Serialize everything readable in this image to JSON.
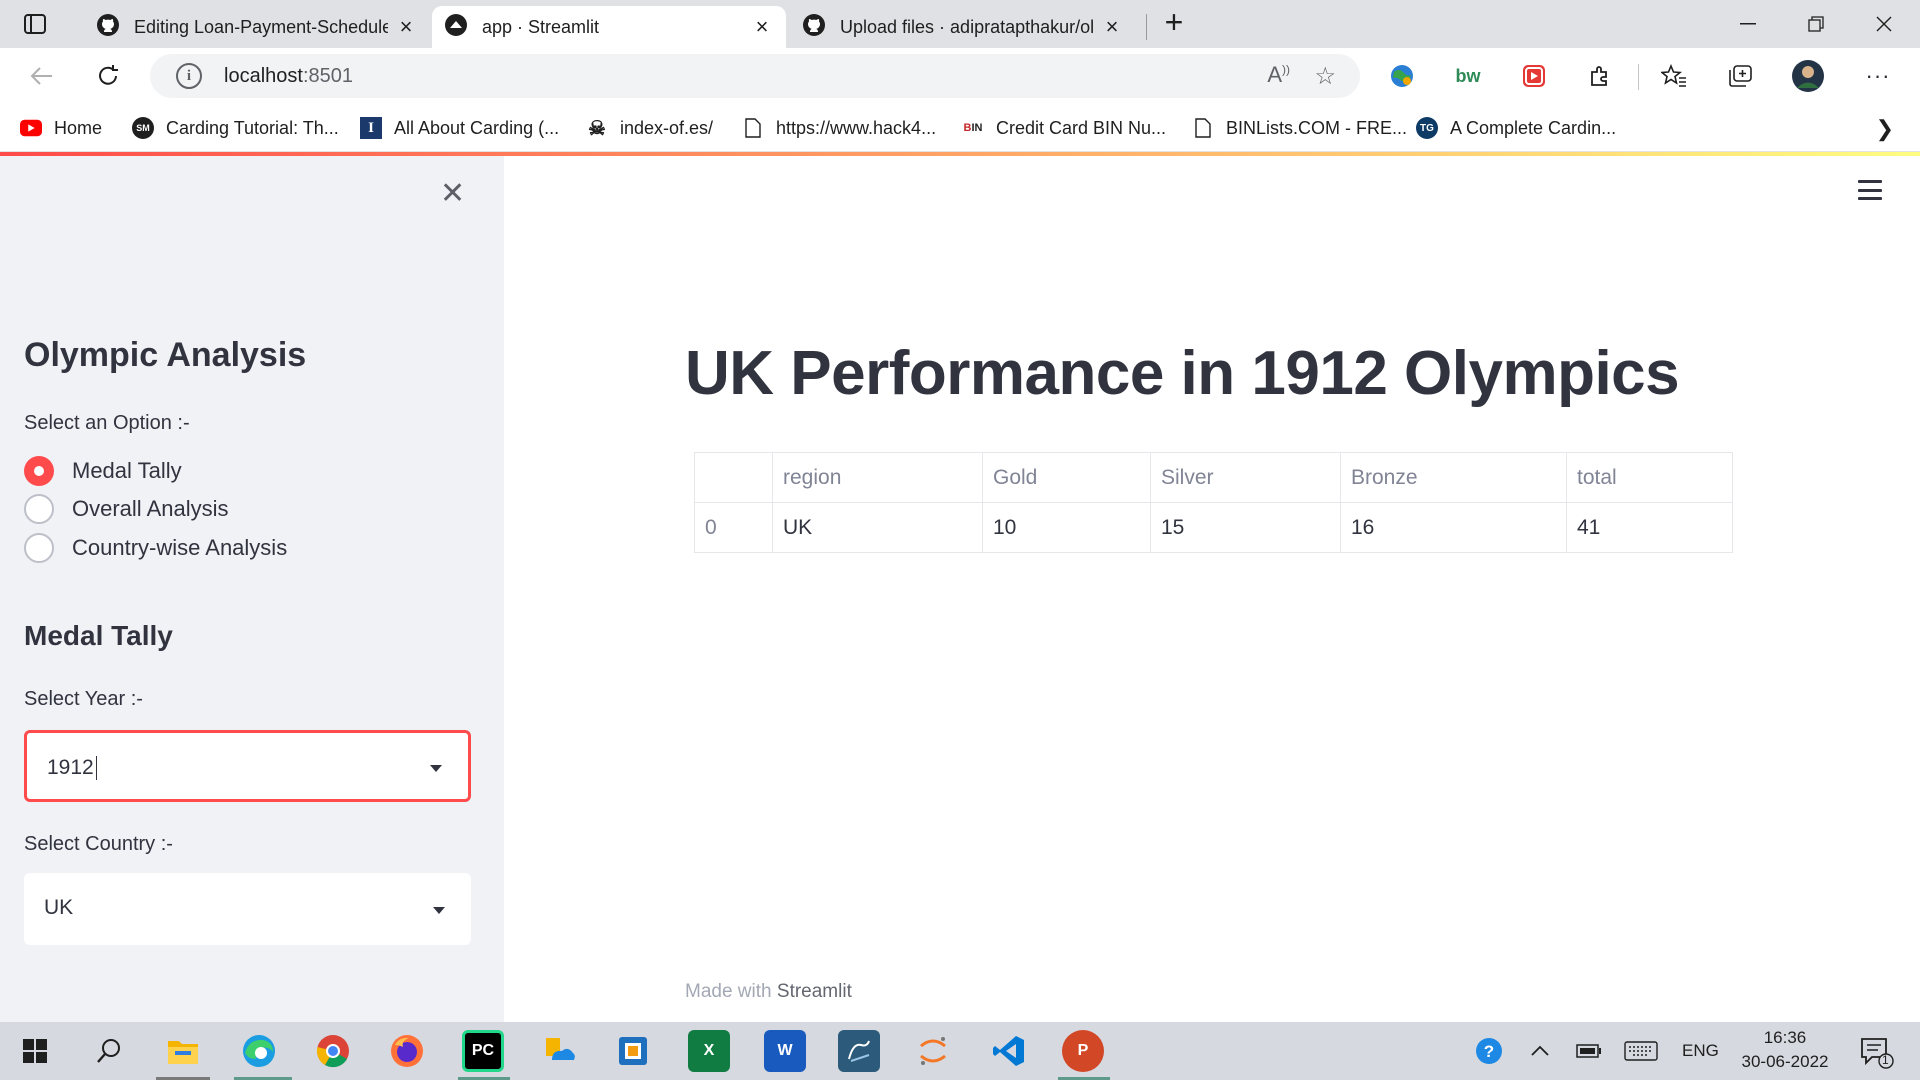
{
  "browser": {
    "tabs": [
      {
        "title": "Editing Loan-Payment-Scheduler",
        "icon": "github-icon",
        "active": false
      },
      {
        "title": "app · Streamlit",
        "icon": "streamlit-icon",
        "active": true
      },
      {
        "title": "Upload files · adipratapthakur/ol",
        "icon": "github-icon",
        "active": false
      }
    ],
    "url": {
      "host": "localhost",
      "port": ":8501"
    },
    "bookmarks": [
      {
        "label": "Home",
        "icon": "youtube-icon"
      },
      {
        "label": "Carding Tutorial: Th...",
        "icon": "sm-icon"
      },
      {
        "label": "All About Carding (...",
        "icon": "i-icon"
      },
      {
        "label": "index-of.es/",
        "icon": "skull-icon"
      },
      {
        "label": "https://www.hack4...",
        "icon": "page-icon"
      },
      {
        "label": "Credit Card BIN Nu...",
        "icon": "bin-icon"
      },
      {
        "label": "BINLists.COM - FRE...",
        "icon": "page-icon"
      },
      {
        "label": "A Complete Cardin...",
        "icon": "tg-icon"
      }
    ],
    "extensions": {
      "bw": "bw"
    }
  },
  "sidebar": {
    "title": "Olympic Analysis",
    "option_label": "Select an Option :-",
    "options": [
      "Medal Tally",
      "Overall Analysis",
      "Country-wise Analysis"
    ],
    "selected_option": "Medal Tally",
    "subheader": "Medal Tally",
    "year_label": "Select Year :-",
    "year_value": "1912",
    "country_label": "Select Country :-",
    "country_value": "UK"
  },
  "main": {
    "title": "UK Performance in 1912 Olympics",
    "table": {
      "columns": [
        "",
        "region",
        "Gold",
        "Silver",
        "Bronze",
        "total"
      ],
      "rows": [
        [
          "0",
          "UK",
          "10",
          "15",
          "16",
          "41"
        ]
      ]
    },
    "footer_prefix": "Made with",
    "footer_brand": "Streamlit"
  },
  "taskbar": {
    "apps": [
      "start-icon",
      "search-icon",
      "file-explorer-icon",
      "edge-icon",
      "chrome-icon",
      "firefox-icon",
      "pycharm-icon",
      "onedrive-icon",
      "virtualbox-icon",
      "excel-icon",
      "word-icon",
      "mysql-workbench-icon",
      "jupyter-icon",
      "vscode-icon",
      "powerpoint-icon"
    ],
    "language": "ENG",
    "time": "16:36",
    "date": "30-06-2022",
    "notification_count": "1"
  },
  "colors": {
    "accent": "#ff4b4b",
    "sidebar_bg": "#f0f2f6",
    "text": "#31333f"
  }
}
